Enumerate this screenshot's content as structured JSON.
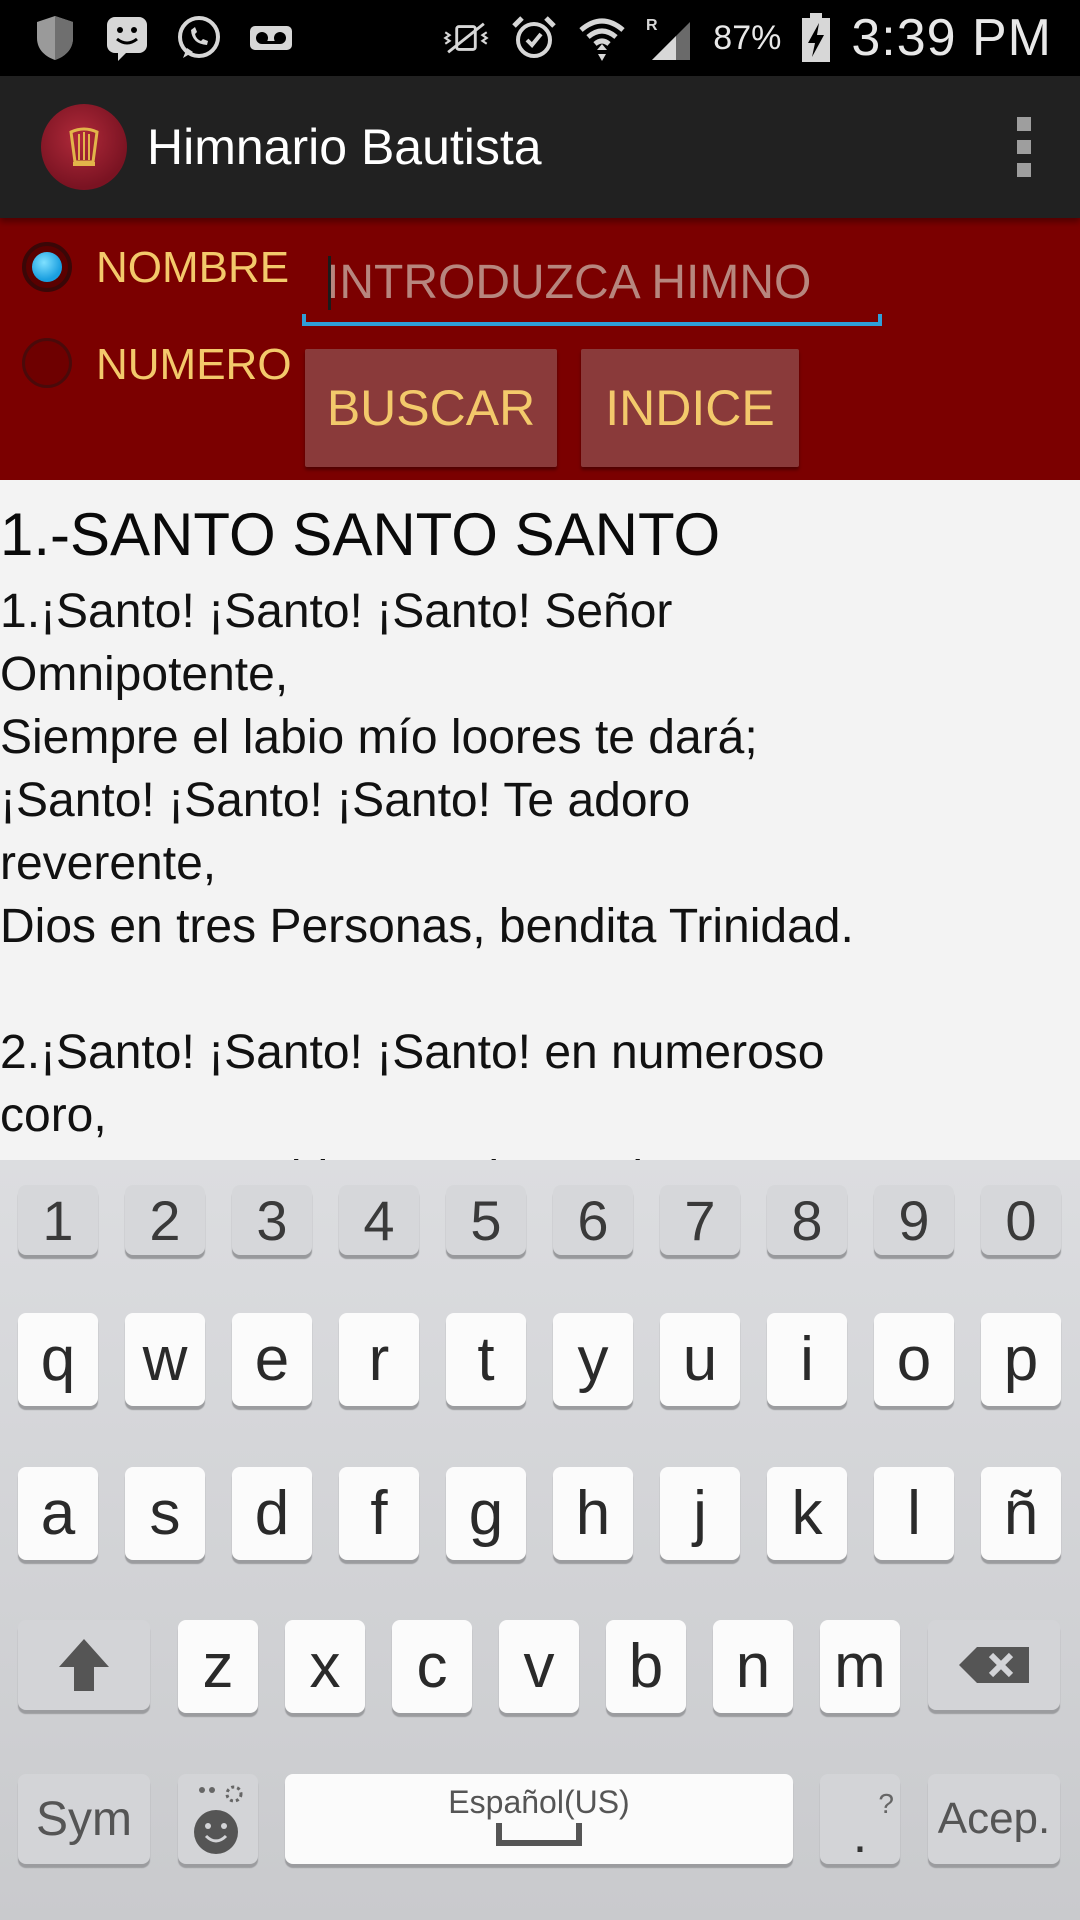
{
  "status_bar": {
    "battery_percent": "87%",
    "time": "3:39 PM",
    "icons_left": [
      "shield-icon",
      "bbm-icon",
      "whatsapp-icon",
      "voicemail-icon"
    ],
    "icons_right": [
      "vibrate-mute-icon",
      "alarm-icon",
      "wifi-icon",
      "signal-roaming-icon",
      "battery-charging-icon"
    ]
  },
  "action_bar": {
    "title": "Himnario Bautista",
    "logo_icon": "harp-logo-icon",
    "overflow_icon": "more-vert-icon"
  },
  "search_panel": {
    "radio_name_label": "NOMBRE",
    "radio_number_label": "NUMERO",
    "selected": "NOMBRE",
    "search_placeholder": "INTRODUZCA HIMNO",
    "search_value": "",
    "search_button": "BUSCAR",
    "index_button": "INDICE",
    "colors": {
      "panel_bg": "#7b0000",
      "label": "#f3c96b",
      "accent": "#2f9fd8"
    }
  },
  "hymn": {
    "title": "1.-SANTO SANTO SANTO",
    "text": "1.¡Santo! ¡Santo! ¡Santo! Señor\nOmnipotente,\nSiempre el labio mío loores te dará;\n¡Santo! ¡Santo! ¡Santo! Te adoro\nreverente,\nDios en tres Personas, bendita Trinidad.\n\n2.¡Santo! ¡Santo! ¡Santo! en numeroso\ncoro,\nSantos escogidos te adoran sin cesar,"
  },
  "keyboard": {
    "row_numbers": [
      "1",
      "2",
      "3",
      "4",
      "5",
      "6",
      "7",
      "8",
      "9",
      "0"
    ],
    "row1": [
      "q",
      "w",
      "e",
      "r",
      "t",
      "y",
      "u",
      "i",
      "o",
      "p"
    ],
    "row2": [
      "a",
      "s",
      "d",
      "f",
      "g",
      "h",
      "j",
      "k",
      "l",
      "ñ"
    ],
    "row3": [
      "z",
      "x",
      "c",
      "v",
      "b",
      "n",
      "m"
    ],
    "sym_label": "Sym",
    "space_label": "Español(US)",
    "period_label": ".",
    "period_hint": "?",
    "enter_label": "Acep.",
    "shift_icon": "shift-arrow-icon",
    "backspace_icon": "backspace-icon",
    "emoji_icon": "emoji-icon"
  }
}
